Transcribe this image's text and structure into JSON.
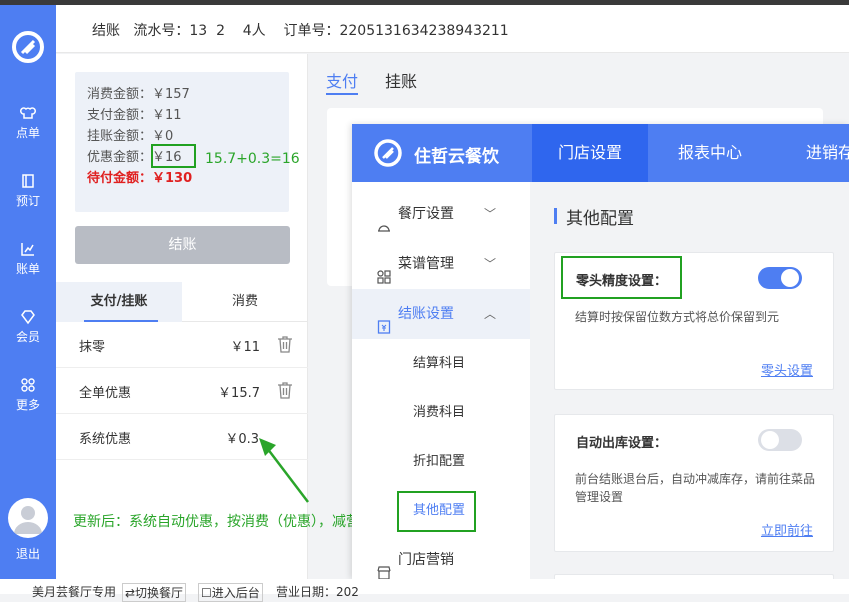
{
  "nav": {
    "items": [
      {
        "label": "点单",
        "icon": "chef-hat-icon"
      },
      {
        "label": "预订",
        "icon": "book-icon"
      },
      {
        "label": "账单",
        "icon": "chart-icon"
      },
      {
        "label": "会员",
        "icon": "diamond-icon"
      },
      {
        "label": "更多",
        "icon": "grid-icon"
      }
    ],
    "logout": "退出"
  },
  "header": {
    "info": "结账   流水号：13  2    4人    订单号：2205131634238943211"
  },
  "summary": {
    "consume": "消费金额：￥157",
    "paid": "支付金额：￥11",
    "credit": "挂账金额：￥0",
    "discount_label": "优惠金额：",
    "discount_value": "￥16",
    "due": "待付金额：￥130"
  },
  "annotations": {
    "formula": "15.7+0.3=16",
    "note": "更新后：系统自动优惠，按消费（优惠），减营收"
  },
  "checkout_button": "结账",
  "panel_tabs": [
    "支付/挂账",
    "消费"
  ],
  "discounts": [
    {
      "name": "抹零",
      "amount": "￥11",
      "deletable": true
    },
    {
      "name": "全单优惠",
      "amount": "￥15.7",
      "deletable": true
    },
    {
      "name": "系统优惠",
      "amount": "￥0.3",
      "deletable": false
    }
  ],
  "pay_tabs": [
    "支付",
    "挂账"
  ],
  "overlay": {
    "brand": "住哲云餐饮",
    "menus": [
      "门店设置",
      "报表中心",
      "进销存"
    ],
    "side": [
      {
        "label": "餐厅设置",
        "chev": "﹀"
      },
      {
        "label": "菜谱管理",
        "chev": "﹀"
      },
      {
        "label": "结账设置",
        "chev": "︿"
      }
    ],
    "sub": [
      "结算科目",
      "消费科目",
      "折扣配置",
      "其他配置"
    ],
    "side_last": "门店营销",
    "section_title": "其他配置",
    "cards": [
      {
        "title": "零头精度设置：",
        "desc": "结算时按保留位数方式将总价保留到元",
        "link": "零头设置",
        "toggle": "on"
      },
      {
        "title": "自动出库设置：",
        "desc": "前台结账退台后，自动冲减库存，请前往菜品管理设置",
        "link": "立即前往",
        "toggle": "off"
      }
    ]
  },
  "footer": {
    "a": "美月芸餐厅专用",
    "b": "⇄切换餐厅",
    "c": "☐进入后台",
    "d": "营业日期：202"
  },
  "colors": {
    "brand": "#4e7ef2",
    "due": "#e02020",
    "annotation": "#2aa52a"
  }
}
